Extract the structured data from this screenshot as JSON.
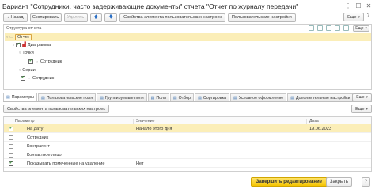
{
  "window": {
    "title": "Вариант \"Сотрудники, часто задерживающие документы\" отчета \"Отчет по журналу передачи\"",
    "more_icon": "more-dots-icon",
    "maximize_icon": "maximize-icon",
    "close_icon": "close-icon"
  },
  "toolbar": {
    "back": "Назад",
    "copy": "Скопировать",
    "delete": "Удалить",
    "up_icon": "arrow-up-icon",
    "down_icon": "arrow-down-icon",
    "element_props": "Свойства элемента пользовательских настроек",
    "user_settings": "Пользовательские настройки",
    "more": "Еще",
    "help": "?"
  },
  "structure": {
    "header": "Структура отчета",
    "more": "Еще",
    "rows": [
      {
        "label": "Отчет",
        "checked": false
      },
      {
        "label": "Диаграмма",
        "checked": true
      },
      {
        "label": "Точки",
        "checked": false
      },
      {
        "label": "Сотрудник",
        "checked": true
      },
      {
        "label": "Серии",
        "checked": false
      },
      {
        "label": "Сотрудник",
        "checked": true
      }
    ]
  },
  "tabs": [
    {
      "label": "Параметры",
      "active": true
    },
    {
      "label": "Пользовательские поля",
      "active": false
    },
    {
      "label": "Группируемые поля",
      "active": false
    },
    {
      "label": "Поля",
      "active": false
    },
    {
      "label": "Отбор",
      "active": false
    },
    {
      "label": "Сортировка",
      "active": false
    },
    {
      "label": "Условное оформление",
      "active": false
    },
    {
      "label": "Дополнительные настройки",
      "active": false
    }
  ],
  "tabs_more": "Еще",
  "params": {
    "props_button": "Свойства элемента пользовательских настроек",
    "more": "Еще",
    "headers": {
      "param": "Параметр",
      "value": "Значение",
      "date": "Дата"
    },
    "rows": [
      {
        "checked": true,
        "param": "На дату",
        "value": "Начало этого дня",
        "date": "19.06.2023"
      },
      {
        "checked": false,
        "param": "Сотрудник",
        "value": "",
        "date": ""
      },
      {
        "checked": false,
        "param": "Контрагент",
        "value": "",
        "date": ""
      },
      {
        "checked": false,
        "param": "Контактное лицо",
        "value": "",
        "date": ""
      },
      {
        "checked": true,
        "param": "Показывать помеченные на удаление",
        "value": "Нет",
        "date": ""
      }
    ]
  },
  "footer": {
    "finish": "Завершить редактирование",
    "close": "Закрыть",
    "help": "?"
  }
}
